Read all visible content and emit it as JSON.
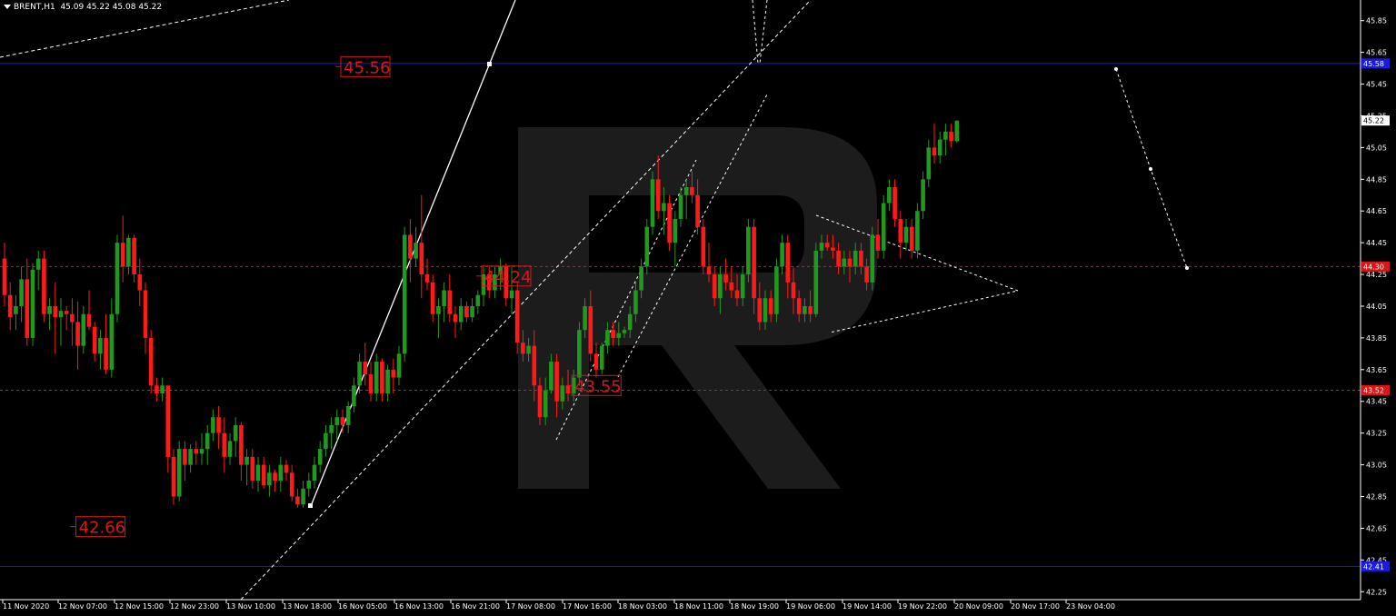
{
  "header": {
    "symbol_info": "BRENT,H1",
    "ohlc": "45.09 45.22 45.08 45.22"
  },
  "colors": {
    "background": "#000000",
    "bull": "#1f9a1f",
    "bear": "#ff1a1a",
    "level_blue": "#1b1bdd",
    "level_red": "#d81818",
    "axis": "#ffffff",
    "watermark": "#1c1c1c"
  },
  "chart_data": {
    "type": "candlestick",
    "title": "BRENT,H1",
    "x_tick_labels": [
      "11 Nov 2020",
      "12 Nov 07:00",
      "12 Nov 15:00",
      "12 Nov 23:00",
      "13 Nov 10:00",
      "13 Nov 18:00",
      "16 Nov 05:00",
      "16 Nov 13:00",
      "16 Nov 21:00",
      "17 Nov 08:00",
      "17 Nov 16:00",
      "18 Nov 03:00",
      "18 Nov 11:00",
      "18 Nov 19:00",
      "19 Nov 06:00",
      "19 Nov 14:00",
      "19 Nov 22:00",
      "20 Nov 09:00",
      "20 Nov 17:00",
      "23 Nov 04:00"
    ],
    "y_tick_labels": [
      "45.85",
      "45.65",
      "45.45",
      "45.25",
      "45.05",
      "44.85",
      "44.65",
      "44.45",
      "44.25",
      "44.05",
      "43.85",
      "43.65",
      "43.45",
      "43.25",
      "43.05",
      "42.85",
      "42.65",
      "42.45",
      "42.25"
    ],
    "ylim": [
      42.2,
      45.98
    ],
    "horizontal_levels": [
      {
        "price": 45.58,
        "color": "blue",
        "style": "solid",
        "axis_tag": "45.58"
      },
      {
        "price": 44.3,
        "color": "red",
        "style": "dashed",
        "axis_tag": "44.30"
      },
      {
        "price": 43.52,
        "color": "red",
        "style": "dashed",
        "axis_tag": "43.52"
      },
      {
        "price": 42.41,
        "color": "blue",
        "style": "solid",
        "axis_tag": "42.41"
      }
    ],
    "current_price_tag": "45.22",
    "annotations": [
      {
        "text": "45.56",
        "price": 45.56,
        "candle": 60
      },
      {
        "text": "44.24",
        "price": 44.24,
        "candle": 85
      },
      {
        "text": "43.55",
        "price": 43.55,
        "candle": 101
      },
      {
        "text": "42.66",
        "price": 42.66,
        "candle": 13
      }
    ],
    "candles": [
      [
        44.35,
        44.45,
        44.05,
        44.12
      ],
      [
        44.12,
        44.2,
        43.9,
        43.98
      ],
      [
        44.0,
        44.12,
        43.9,
        44.05
      ],
      [
        44.05,
        44.3,
        43.95,
        44.22
      ],
      [
        44.22,
        44.35,
        43.8,
        43.85
      ],
      [
        43.85,
        44.32,
        43.8,
        44.28
      ],
      [
        44.28,
        44.4,
        44.15,
        44.35
      ],
      [
        44.35,
        44.4,
        43.95,
        44.0
      ],
      [
        44.0,
        44.1,
        43.9,
        44.05
      ],
      [
        44.05,
        44.2,
        43.75,
        43.98
      ],
      [
        43.98,
        44.1,
        43.8,
        44.02
      ],
      [
        44.02,
        44.05,
        43.9,
        44.0
      ],
      [
        44.0,
        44.1,
        43.8,
        43.95
      ],
      [
        43.95,
        44.08,
        43.65,
        43.8
      ],
      [
        43.8,
        44.05,
        43.75,
        44.0
      ],
      [
        44.0,
        44.15,
        43.9,
        43.92
      ],
      [
        43.92,
        43.95,
        43.7,
        43.75
      ],
      [
        43.75,
        43.9,
        43.65,
        43.85
      ],
      [
        43.85,
        44.0,
        43.62,
        43.65
      ],
      [
        43.65,
        44.1,
        43.6,
        44.0
      ],
      [
        44.0,
        44.5,
        43.95,
        44.45
      ],
      [
        44.45,
        44.62,
        44.2,
        44.3
      ],
      [
        44.3,
        44.5,
        44.25,
        44.48
      ],
      [
        44.48,
        44.5,
        44.2,
        44.25
      ],
      [
        44.25,
        44.35,
        44.05,
        44.15
      ],
      [
        44.15,
        44.2,
        43.75,
        43.85
      ],
      [
        43.85,
        43.9,
        43.5,
        43.55
      ],
      [
        43.55,
        43.6,
        43.45,
        43.5
      ],
      [
        43.5,
        43.6,
        43.45,
        43.55
      ],
      [
        43.55,
        43.38,
        43.0,
        43.1
      ],
      [
        43.1,
        43.15,
        42.8,
        42.85
      ],
      [
        42.85,
        43.2,
        42.82,
        43.15
      ],
      [
        43.15,
        43.2,
        42.95,
        43.05
      ],
      [
        43.05,
        43.18,
        43.0,
        43.15
      ],
      [
        43.15,
        43.2,
        43.05,
        43.12
      ],
      [
        43.12,
        43.25,
        43.05,
        43.15
      ],
      [
        43.15,
        43.3,
        43.05,
        43.25
      ],
      [
        43.25,
        43.4,
        43.2,
        43.35
      ],
      [
        43.35,
        43.42,
        43.15,
        43.25
      ],
      [
        43.25,
        43.35,
        43.0,
        43.1
      ],
      [
        43.1,
        43.25,
        43.05,
        43.2
      ],
      [
        43.2,
        43.35,
        43.1,
        43.3
      ],
      [
        43.3,
        43.32,
        42.95,
        43.05
      ],
      [
        43.05,
        43.15,
        42.92,
        43.1
      ],
      [
        43.1,
        43.15,
        42.9,
        42.95
      ],
      [
        42.95,
        43.1,
        42.88,
        43.05
      ],
      [
        43.05,
        43.1,
        42.9,
        42.92
      ],
      [
        42.92,
        43.05,
        42.85,
        43.0
      ],
      [
        43.0,
        43.02,
        42.88,
        42.95
      ],
      [
        42.95,
        43.1,
        42.88,
        43.05
      ],
      [
        43.05,
        43.08,
        42.95,
        43.0
      ],
      [
        43.0,
        43.05,
        42.82,
        42.85
      ],
      [
        42.85,
        42.9,
        42.78,
        42.8
      ],
      [
        42.8,
        42.95,
        42.78,
        42.9
      ],
      [
        42.9,
        43.0,
        42.85,
        42.95
      ],
      [
        42.95,
        43.1,
        42.9,
        43.05
      ],
      [
        43.05,
        43.2,
        43.0,
        43.15
      ],
      [
        43.15,
        43.3,
        43.1,
        43.25
      ],
      [
        43.25,
        43.35,
        43.15,
        43.3
      ],
      [
        43.3,
        43.4,
        43.2,
        43.35
      ],
      [
        43.35,
        43.4,
        43.25,
        43.3
      ],
      [
        43.3,
        43.45,
        43.25,
        43.42
      ],
      [
        43.42,
        43.6,
        43.38,
        43.55
      ],
      [
        43.55,
        43.75,
        43.5,
        43.7
      ],
      [
        43.7,
        43.82,
        43.55,
        43.62
      ],
      [
        43.62,
        43.7,
        43.45,
        43.5
      ],
      [
        43.5,
        43.75,
        43.45,
        43.7
      ],
      [
        43.7,
        43.72,
        43.45,
        43.5
      ],
      [
        43.5,
        43.68,
        43.45,
        43.65
      ],
      [
        43.65,
        43.72,
        43.5,
        43.6
      ],
      [
        43.6,
        43.8,
        43.55,
        43.75
      ],
      [
        43.75,
        44.55,
        43.7,
        44.5
      ],
      [
        44.5,
        44.6,
        44.2,
        44.35
      ],
      [
        44.35,
        44.55,
        44.3,
        44.45
      ],
      [
        44.45,
        44.75,
        44.1,
        44.25
      ],
      [
        44.25,
        44.35,
        44.15,
        44.2
      ],
      [
        44.2,
        44.25,
        43.95,
        44.0
      ],
      [
        44.0,
        44.1,
        43.85,
        44.05
      ],
      [
        44.05,
        44.2,
        43.95,
        44.15
      ],
      [
        44.15,
        44.25,
        43.95,
        44.0
      ],
      [
        44.0,
        44.05,
        43.85,
        43.95
      ],
      [
        43.95,
        44.1,
        43.9,
        44.05
      ],
      [
        44.05,
        44.08,
        43.95,
        43.98
      ],
      [
        43.98,
        44.1,
        43.95,
        44.05
      ],
      [
        44.05,
        44.15,
        44.0,
        44.12
      ],
      [
        44.12,
        44.3,
        44.05,
        44.25
      ],
      [
        44.25,
        44.3,
        44.1,
        44.15
      ],
      [
        44.15,
        44.3,
        44.1,
        44.25
      ],
      [
        44.25,
        44.35,
        44.15,
        44.3
      ],
      [
        44.3,
        44.32,
        44.05,
        44.1
      ],
      [
        44.1,
        44.3,
        44.0,
        44.15
      ],
      [
        44.15,
        44.2,
        43.75,
        43.82
      ],
      [
        43.82,
        43.9,
        43.7,
        43.75
      ],
      [
        43.75,
        43.85,
        43.7,
        43.8
      ],
      [
        43.8,
        43.9,
        43.45,
        43.55
      ],
      [
        43.55,
        43.6,
        43.3,
        43.35
      ],
      [
        43.35,
        43.6,
        43.3,
        43.52
      ],
      [
        43.52,
        43.75,
        43.5,
        43.7
      ],
      [
        43.7,
        43.75,
        43.35,
        43.45
      ],
      [
        43.45,
        43.6,
        43.4,
        43.55
      ],
      [
        43.55,
        43.65,
        43.45,
        43.5
      ],
      [
        43.5,
        43.65,
        43.45,
        43.6
      ],
      [
        43.6,
        43.95,
        43.55,
        43.9
      ],
      [
        43.9,
        44.1,
        43.85,
        44.05
      ],
      [
        44.05,
        44.15,
        43.7,
        43.75
      ],
      [
        43.75,
        43.82,
        43.6,
        43.65
      ],
      [
        43.65,
        43.82,
        43.62,
        43.8
      ],
      [
        43.8,
        43.95,
        43.75,
        43.9
      ],
      [
        43.9,
        43.95,
        43.8,
        43.85
      ],
      [
        43.85,
        43.95,
        43.8,
        43.88
      ],
      [
        43.88,
        43.92,
        43.85,
        43.9
      ],
      [
        43.9,
        44.05,
        43.85,
        44.0
      ],
      [
        44.0,
        44.2,
        43.95,
        44.15
      ],
      [
        44.15,
        44.35,
        44.1,
        44.3
      ],
      [
        44.3,
        44.6,
        44.25,
        44.55
      ],
      [
        44.55,
        44.9,
        44.5,
        44.85
      ],
      [
        44.85,
        45.0,
        44.6,
        44.65
      ],
      [
        44.65,
        44.8,
        44.5,
        44.7
      ],
      [
        44.7,
        44.75,
        44.4,
        44.45
      ],
      [
        44.45,
        44.65,
        44.3,
        44.6
      ],
      [
        44.6,
        44.8,
        44.55,
        44.75
      ],
      [
        44.75,
        44.85,
        44.6,
        44.8
      ],
      [
        44.8,
        44.9,
        44.7,
        44.75
      ],
      [
        44.75,
        44.85,
        44.5,
        44.55
      ],
      [
        44.55,
        44.6,
        44.25,
        44.3
      ],
      [
        44.3,
        44.45,
        44.2,
        44.25
      ],
      [
        44.25,
        44.3,
        44.05,
        44.1
      ],
      [
        44.1,
        44.3,
        44.0,
        44.25
      ],
      [
        44.25,
        44.35,
        44.15,
        44.2
      ],
      [
        44.2,
        44.3,
        44.1,
        44.15
      ],
      [
        44.15,
        44.25,
        44.05,
        44.1
      ],
      [
        44.1,
        44.3,
        44.05,
        44.25
      ],
      [
        44.25,
        44.6,
        44.2,
        44.55
      ],
      [
        44.55,
        44.6,
        44.0,
        44.1
      ],
      [
        44.1,
        44.2,
        43.9,
        43.95
      ],
      [
        43.95,
        44.15,
        43.9,
        44.1
      ],
      [
        44.1,
        44.15,
        43.95,
        44.0
      ],
      [
        44.0,
        44.35,
        43.95,
        44.3
      ],
      [
        44.3,
        44.5,
        44.25,
        44.45
      ],
      [
        44.45,
        44.5,
        44.1,
        44.2
      ],
      [
        44.2,
        44.3,
        44.0,
        44.1
      ],
      [
        44.1,
        44.15,
        43.95,
        44.0
      ],
      [
        44.0,
        44.1,
        43.95,
        44.05
      ],
      [
        44.05,
        44.15,
        43.95,
        44.0
      ],
      [
        44.0,
        44.45,
        43.98,
        44.4
      ],
      [
        44.4,
        44.5,
        44.35,
        44.45
      ],
      [
        44.45,
        44.5,
        44.4,
        44.42
      ],
      [
        44.42,
        44.5,
        44.35,
        44.4
      ],
      [
        44.4,
        44.45,
        44.25,
        44.3
      ],
      [
        44.3,
        44.4,
        44.25,
        44.35
      ],
      [
        44.35,
        44.4,
        44.2,
        44.3
      ],
      [
        44.3,
        44.45,
        44.25,
        44.4
      ],
      [
        44.4,
        44.45,
        44.25,
        44.3
      ],
      [
        44.3,
        44.35,
        44.15,
        44.2
      ],
      [
        44.2,
        44.55,
        44.15,
        44.5
      ],
      [
        44.5,
        44.6,
        44.35,
        44.4
      ],
      [
        44.4,
        44.75,
        44.35,
        44.7
      ],
      [
        44.7,
        44.85,
        44.65,
        44.8
      ],
      [
        44.8,
        44.85,
        44.55,
        44.6
      ],
      [
        44.6,
        44.65,
        44.35,
        44.45
      ],
      [
        44.45,
        44.6,
        44.4,
        44.55
      ],
      [
        44.55,
        44.6,
        44.35,
        44.4
      ],
      [
        44.4,
        44.7,
        44.35,
        44.65
      ],
      [
        44.65,
        44.9,
        44.6,
        44.85
      ],
      [
        44.85,
        45.1,
        44.8,
        45.05
      ],
      [
        45.05,
        45.2,
        44.95,
        45.0
      ],
      [
        45.0,
        45.15,
        44.95,
        45.1
      ],
      [
        45.1,
        45.2,
        45.0,
        45.15
      ],
      [
        45.15,
        45.2,
        45.05,
        45.09
      ],
      [
        45.09,
        45.22,
        45.08,
        45.22
      ]
    ]
  }
}
